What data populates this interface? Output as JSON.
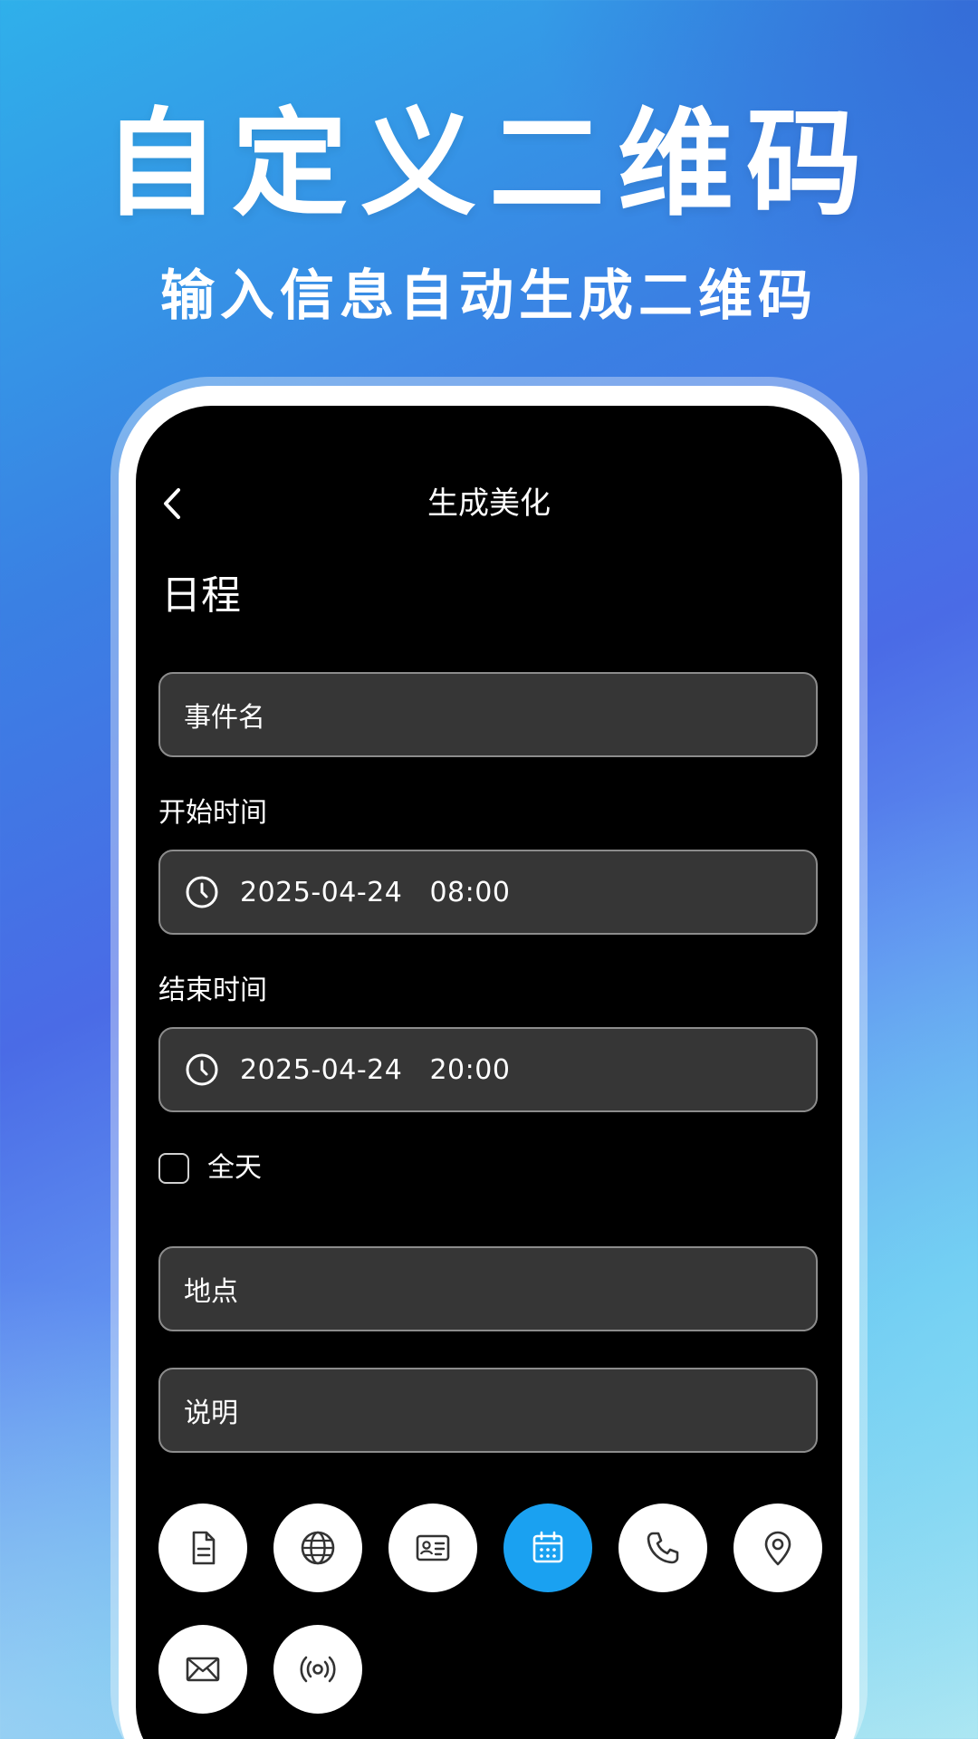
{
  "promo": {
    "headline": "自定义二维码",
    "subheadline": "输入信息自动生成二维码"
  },
  "nav": {
    "title": "生成美化",
    "back_icon": "chevron-left-icon"
  },
  "form": {
    "section_title": "日程",
    "event_name_placeholder": "事件名",
    "start_label": "开始时间",
    "start_value": "2025-04-24   08:00",
    "end_label": "结束时间",
    "end_value": "2025-04-24   20:00",
    "all_day_label": "全天",
    "all_day_checked": false,
    "location_placeholder": "地点",
    "description_placeholder": "说明"
  },
  "qr_types": [
    {
      "icon": "document-icon",
      "active": false
    },
    {
      "icon": "globe-icon",
      "active": false
    },
    {
      "icon": "contact-card-icon",
      "active": false
    },
    {
      "icon": "calendar-icon",
      "active": true
    },
    {
      "icon": "phone-icon",
      "active": false
    },
    {
      "icon": "location-pin-icon",
      "active": false
    },
    {
      "icon": "mail-icon",
      "active": false
    },
    {
      "icon": "broadcast-icon",
      "active": false
    }
  ],
  "colors": {
    "screen_bg": "#000000",
    "field_bg": "#363636",
    "field_border": "#8c8c8c",
    "active_accent": "#1aa1f1",
    "icon_stroke": "#333333"
  }
}
